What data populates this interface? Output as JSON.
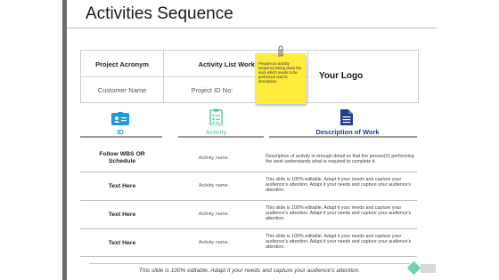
{
  "title": "Activities Sequence",
  "header": {
    "project_acronym": "Project Acronym",
    "activity_list_worksheet": "Activity List Worksheet",
    "customer_name": "Customer Name",
    "project_id": "Project ID No:",
    "logo": "Your Logo"
  },
  "note": {
    "text": "Prepare an activity sequence listing down the work which needs to be performed and its description"
  },
  "columns": [
    {
      "label": "ID",
      "icon": "id-card-icon",
      "color": "#1f9bd7"
    },
    {
      "label": "Activity",
      "icon": "clipboard-icon",
      "color": "#5cc6a4"
    },
    {
      "label": "Description of Work",
      "icon": "document-icon",
      "color": "#1e3f8a"
    }
  ],
  "rows": [
    {
      "id": "Follow WBS OR Schedule",
      "activity": "Activity name.",
      "description": "Description of activity in enough detail so that the person(S) performing the work understands what is required to complete it."
    },
    {
      "id": "Text Here",
      "activity": "Activity name.",
      "description": "This slide is 100% editable. Adapt it your needs and capture your audience's attention. Adapt it your needs and capture your audience's attention."
    },
    {
      "id": "Text Here",
      "activity": "Activity name.",
      "description": "This slide is 100% editable. Adapt it your needs and capture your audience's attention. Adapt it your needs and capture your audience's attention."
    },
    {
      "id": "Text Here",
      "activity": "Activity name.",
      "description": "This slide is 100% editable. Adapt it your needs and capture your audience's attention. Adapt it your needs and capture your audience's attention."
    }
  ],
  "footer": "This slide is 100% editable. Adapt it your needs and capture your audience's attention.",
  "colors": {
    "accent_green": "#6fd3b3",
    "id_blue": "#1f9bd7",
    "doc_navy": "#1e3f8a",
    "note_yellow": "#ffeb3b"
  }
}
